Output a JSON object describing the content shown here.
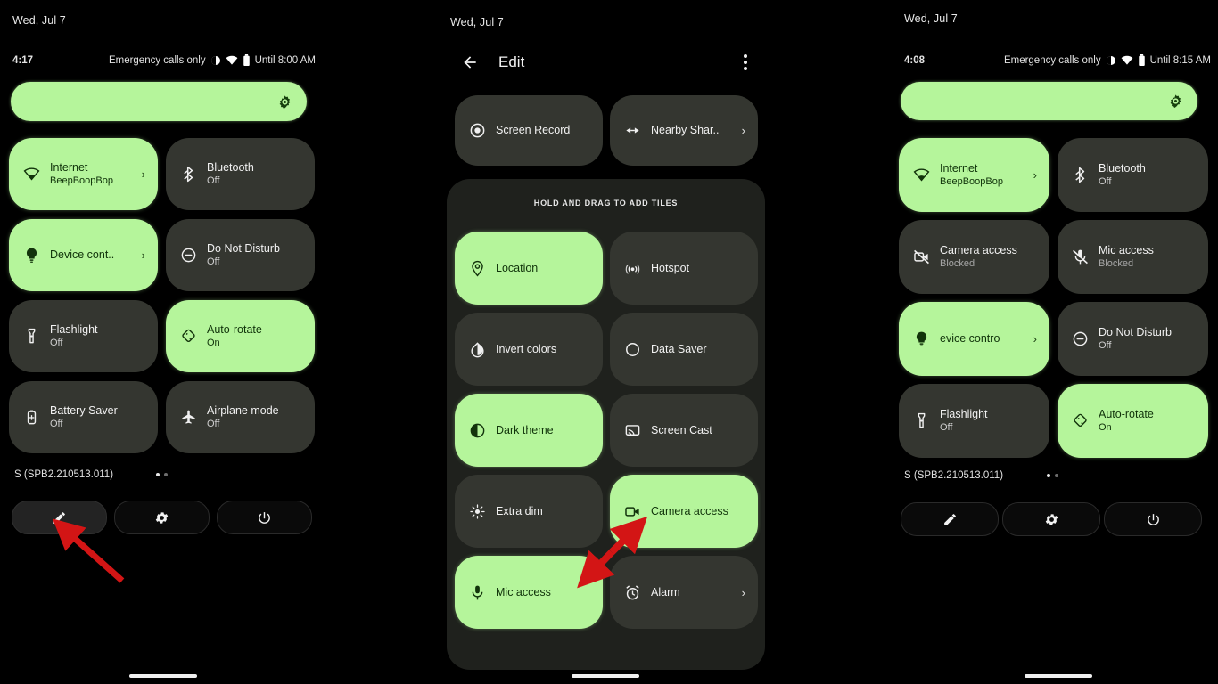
{
  "theme": {
    "accent_green": "#b5f59b",
    "tile_off_bg": "#343630",
    "screen_bg": "#000000",
    "sheet_bg": "#1f211d",
    "arrow_color": "#d31515"
  },
  "panel_left": {
    "date": "Wed, Jul 7",
    "status": {
      "clock": "4:17",
      "carrier": "Emergency calls only",
      "battery_text": "Until 8:00 AM",
      "icons": [
        "dnd-icon",
        "wifi-icon",
        "battery-icon"
      ]
    },
    "brightness": {
      "icon": "auto-brightness-icon",
      "level_label": ""
    },
    "tiles": [
      {
        "name": "Internet",
        "sub": "BeepBoopBop",
        "icon": "wifi-icon",
        "on": true,
        "chevron": true
      },
      {
        "name": "Bluetooth",
        "sub": "Off",
        "icon": "bluetooth-icon",
        "on": false,
        "chevron": false
      },
      {
        "name": "Device cont..",
        "sub": "",
        "icon": "device-controls-icon",
        "on": true,
        "chevron": true
      },
      {
        "name": "Do Not Disturb",
        "sub": "Off",
        "icon": "dnd-icon",
        "on": false,
        "chevron": false
      },
      {
        "name": "Flashlight",
        "sub": "Off",
        "icon": "flashlight-icon",
        "on": false,
        "chevron": false
      },
      {
        "name": "Auto-rotate",
        "sub": "On",
        "icon": "auto-rotate-icon",
        "on": true,
        "chevron": false
      },
      {
        "name": "Battery Saver",
        "sub": "Off",
        "icon": "battery-saver-icon",
        "on": false,
        "chevron": false
      },
      {
        "name": "Airplane mode",
        "sub": "Off",
        "icon": "airplane-icon",
        "on": false,
        "chevron": false
      }
    ],
    "footer": {
      "build": "S (SPB2.210513.011)",
      "page_dots": 2,
      "active_dot": 0,
      "buttons": [
        {
          "icon": "pencil-icon",
          "name": "edit-tiles-button"
        },
        {
          "icon": "gear-icon",
          "name": "settings-button"
        },
        {
          "icon": "power-icon",
          "name": "power-button"
        }
      ]
    },
    "annotation": {
      "type": "arrow",
      "target": "edit-tiles-button"
    }
  },
  "panel_mid": {
    "date": "Wed, Jul 7",
    "header": {
      "back_icon": "back-arrow-icon",
      "title": "Edit",
      "overflow_icon": "more-vertical-icon"
    },
    "active_tiles": [
      {
        "name": "Screen Record",
        "icon": "screen-record-icon",
        "on": false,
        "chevron": false
      },
      {
        "name": "Nearby Shar..",
        "icon": "nearby-share-icon",
        "on": false,
        "chevron": true
      }
    ],
    "sheet": {
      "hint": "HOLD AND DRAG TO ADD TILES",
      "tiles": [
        {
          "name": "Location",
          "icon": "location-icon",
          "on": true,
          "chevron": false
        },
        {
          "name": "Hotspot",
          "icon": "hotspot-icon",
          "on": false,
          "chevron": false
        },
        {
          "name": "Invert colors",
          "icon": "invert-colors-icon",
          "on": false,
          "chevron": false
        },
        {
          "name": "Data Saver",
          "icon": "data-saver-icon",
          "on": false,
          "chevron": false
        },
        {
          "name": "Dark theme",
          "icon": "dark-theme-icon",
          "on": true,
          "chevron": false
        },
        {
          "name": "Screen Cast",
          "icon": "screen-cast-icon",
          "on": false,
          "chevron": false
        },
        {
          "name": "Extra dim",
          "icon": "extra-dim-icon",
          "on": false,
          "chevron": false
        },
        {
          "name": "Camera access",
          "icon": "camera-access-icon",
          "on": true,
          "chevron": false
        },
        {
          "name": "Mic access",
          "icon": "mic-access-icon",
          "on": true,
          "chevron": false
        },
        {
          "name": "Alarm",
          "icon": "alarm-icon",
          "on": false,
          "chevron": true
        }
      ]
    },
    "annotation": {
      "type": "double-arrow",
      "from": "mic-access-tile",
      "to": "camera-access-tile"
    }
  },
  "panel_right": {
    "date": "Wed, Jul 7",
    "status": {
      "clock": "4:08",
      "carrier": "Emergency calls only",
      "battery_text": "Until 8:15 AM",
      "icons": [
        "dnd-icon",
        "wifi-icon",
        "battery-icon"
      ]
    },
    "brightness": {
      "icon": "auto-brightness-icon",
      "level_label": ""
    },
    "tiles": [
      {
        "name": "Internet",
        "sub": "BeepBoopBop",
        "icon": "wifi-icon",
        "on": true,
        "chevron": true
      },
      {
        "name": "Bluetooth",
        "sub": "Off",
        "icon": "bluetooth-icon",
        "on": false,
        "chevron": false
      },
      {
        "name": "Camera access",
        "sub": "Blocked",
        "icon": "camera-blocked-icon",
        "on": false,
        "chevron": false
      },
      {
        "name": "Mic access",
        "sub": "Blocked",
        "icon": "mic-blocked-icon",
        "on": false,
        "chevron": false
      },
      {
        "name": "evice contro",
        "sub": "",
        "icon": "device-controls-icon",
        "on": true,
        "chevron": true
      },
      {
        "name": "Do Not Disturb",
        "sub": "Off",
        "icon": "dnd-icon",
        "on": false,
        "chevron": false
      },
      {
        "name": "Flashlight",
        "sub": "Off",
        "icon": "flashlight-icon",
        "on": false,
        "chevron": false
      },
      {
        "name": "Auto-rotate",
        "sub": "On",
        "icon": "auto-rotate-icon",
        "on": true,
        "chevron": false
      }
    ],
    "footer": {
      "build": "S (SPB2.210513.011)",
      "page_dots": 2,
      "active_dot": 0,
      "buttons": [
        {
          "icon": "pencil-icon",
          "name": "edit-tiles-button"
        },
        {
          "icon": "gear-icon",
          "name": "settings-button"
        },
        {
          "icon": "power-icon",
          "name": "power-button"
        }
      ]
    }
  }
}
